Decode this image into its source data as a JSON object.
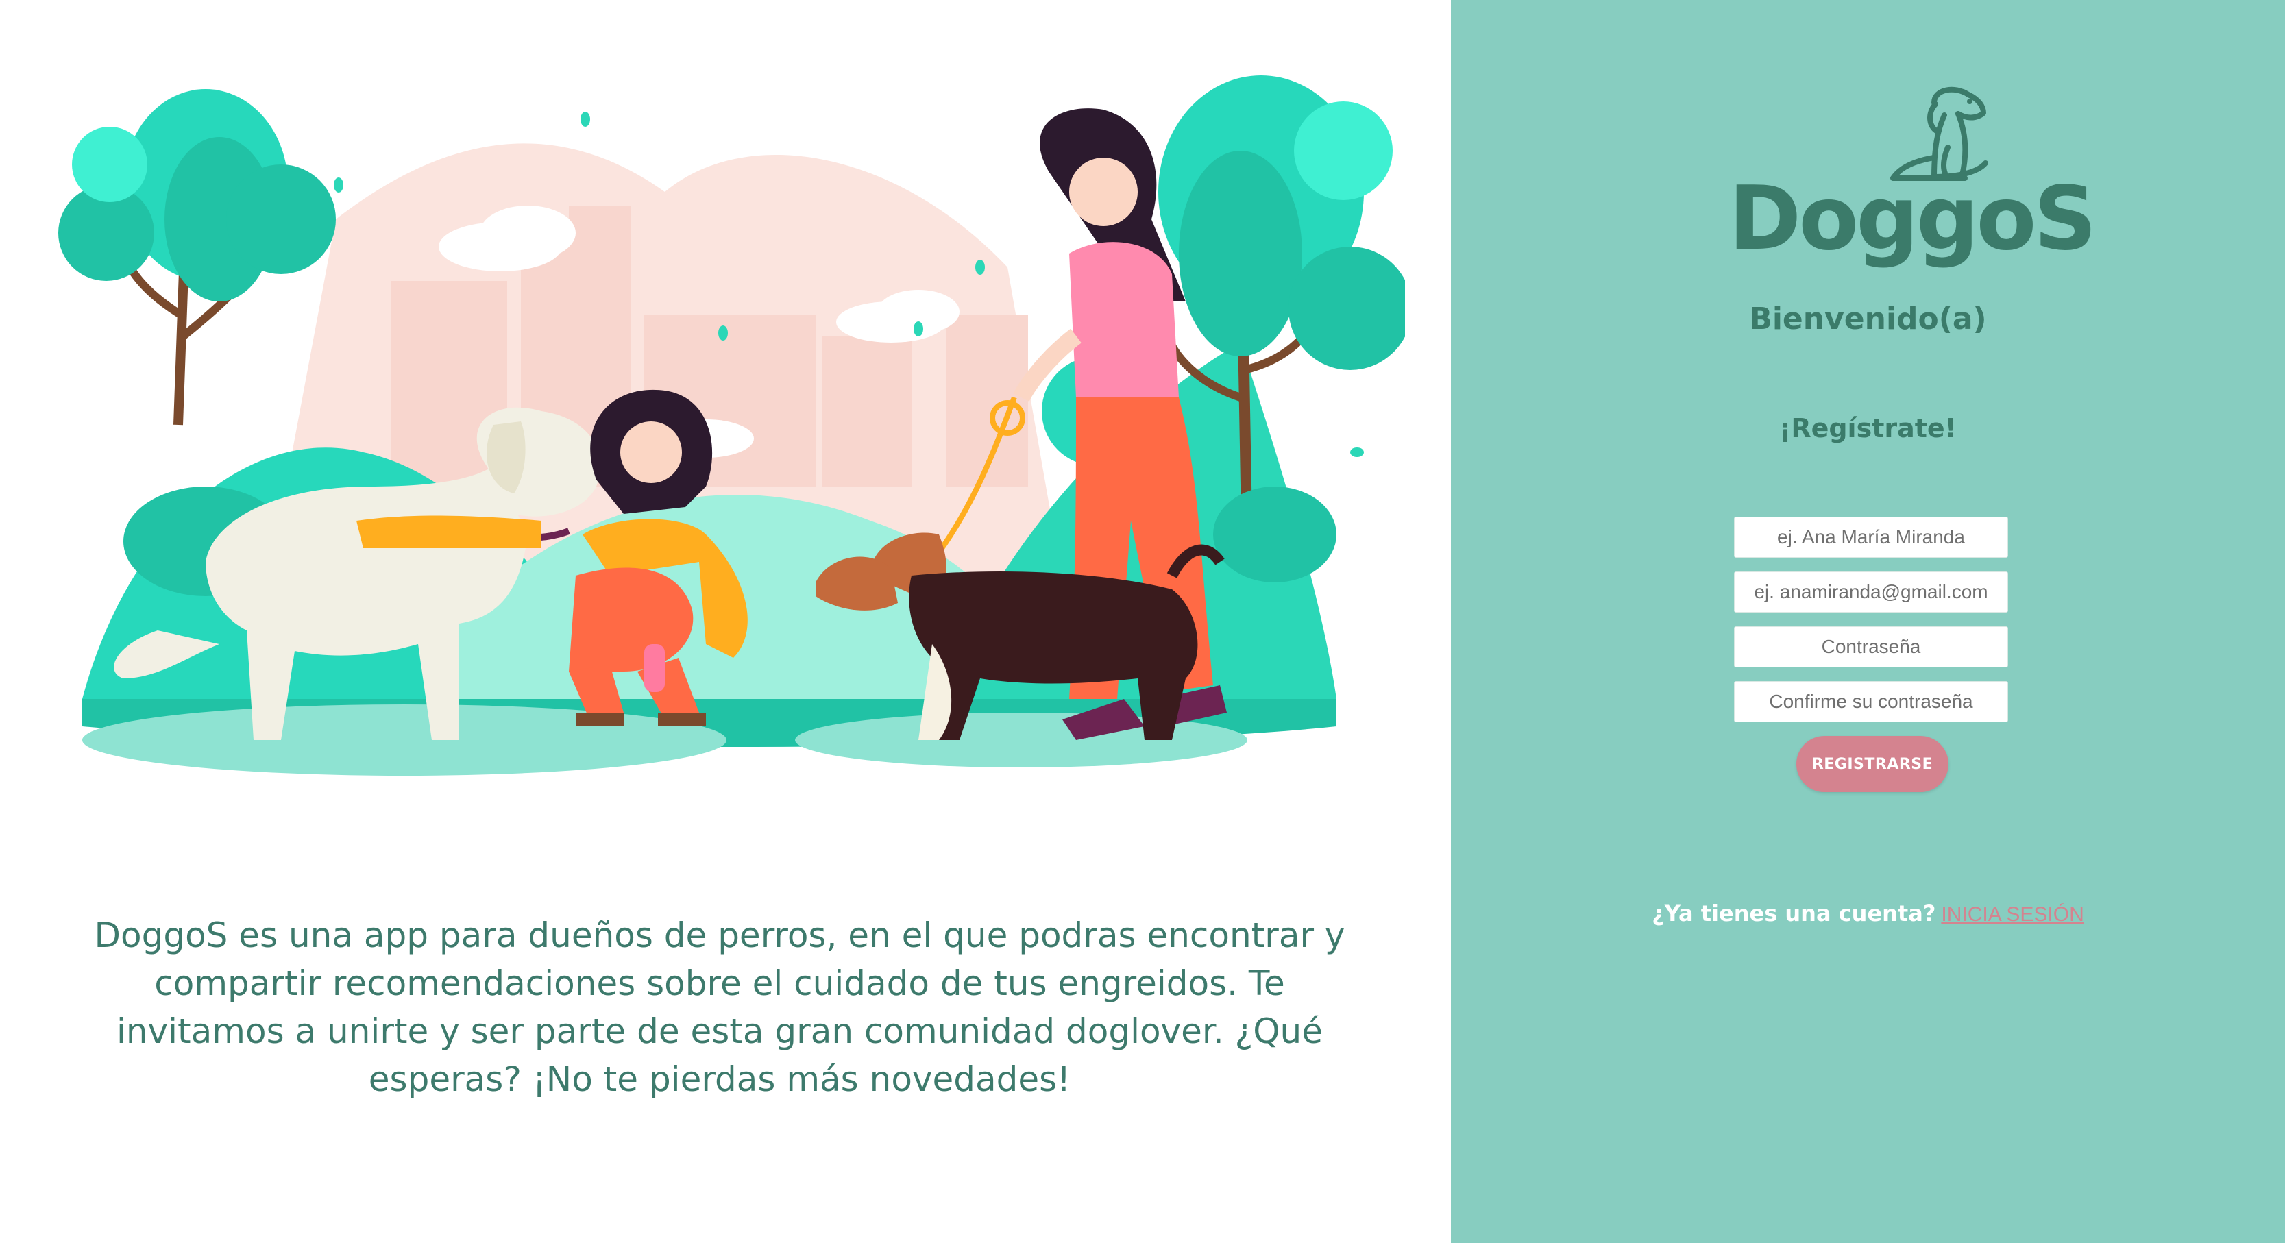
{
  "intro": {
    "text": "DoggoS es una app para dueños de perros, en el que podras encontrar y compartir recomendaciones sobre el cuidado de tus engreidos. Te invitamos a unirte y ser parte de esta gran comunidad doglover. ¿Qué esperas? ¡No te pierdas más novedades!"
  },
  "brand": {
    "logo_text": "DoggoS",
    "color": "#3b7b6a"
  },
  "form": {
    "welcome": "Bienvenido(a)",
    "title": "¡Regístrate!",
    "name_placeholder": "ej. Ana María Miranda",
    "email_placeholder": "ej. anamiranda@gmail.com",
    "password_placeholder": "Contraseña",
    "confirm_placeholder": "Confirme su contraseña",
    "submit_label": "REGISTRARSE"
  },
  "login": {
    "prompt": "¿Ya tienes una cuenta?",
    "link_label": "INICIA SESIÓN"
  },
  "colors": {
    "panel": "#87cdc0",
    "accent": "#d4838f",
    "text": "#3d7a6c"
  },
  "icons": {
    "logo": "sitting-dog-icon",
    "illustration": "people-walking-dogs-in-park"
  }
}
